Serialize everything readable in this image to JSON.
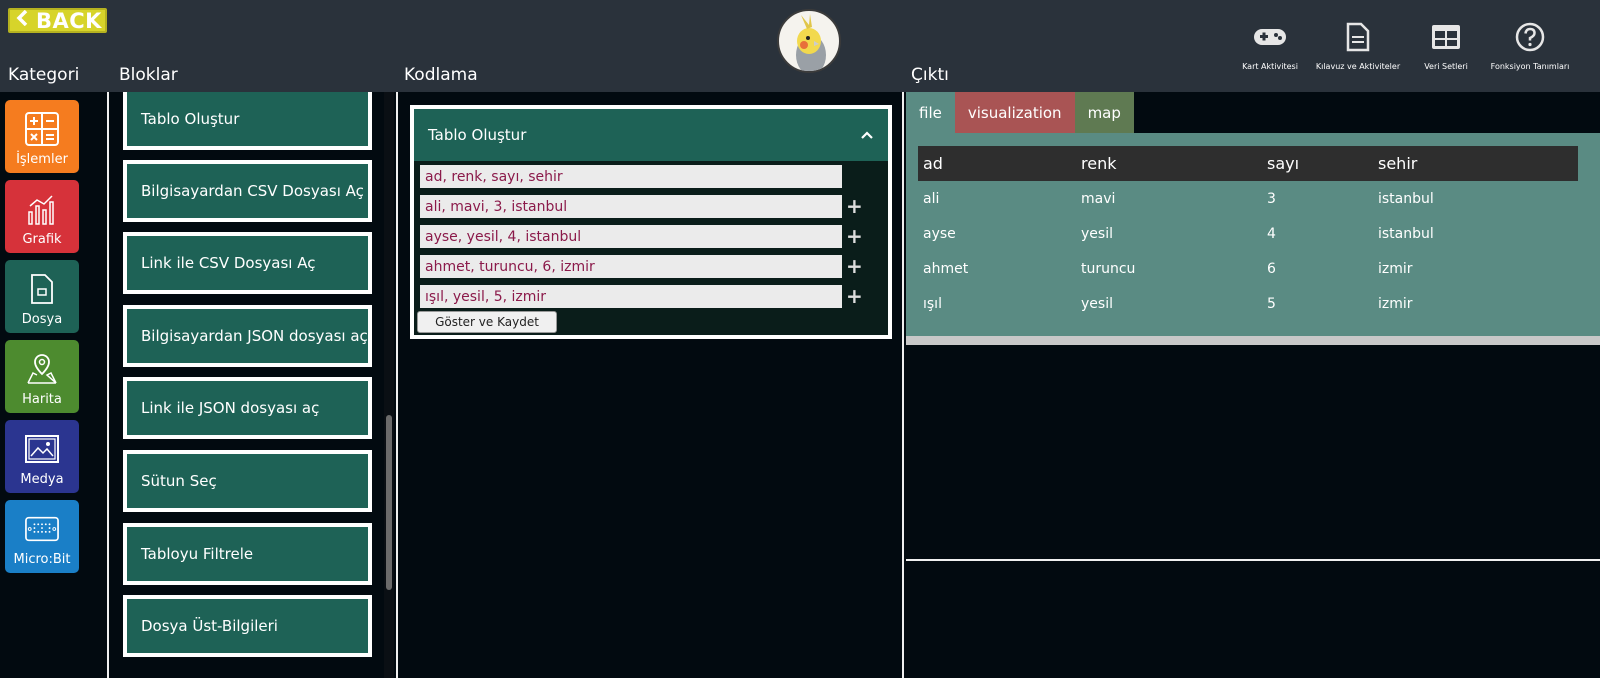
{
  "header": {
    "back_label": "BACK",
    "columns": {
      "kategori": "Kategori",
      "bloklar": "Bloklar",
      "kodlama": "Kodlama",
      "cikti": "Çıktı"
    },
    "icons": [
      {
        "name": "gamepad-icon",
        "label": "Kart Aktivitesi"
      },
      {
        "name": "document-icon",
        "label": "Kılavuz ve Aktiviteler"
      },
      {
        "name": "table-icon",
        "label": "Veri Setleri"
      },
      {
        "name": "help-icon",
        "label": "Fonksiyon Tanımları"
      }
    ]
  },
  "categories": [
    {
      "label": "İşlemler",
      "color": "#f57c1f",
      "icon": "calculator-icon"
    },
    {
      "label": "Grafik",
      "color": "#d6323a",
      "icon": "chart-icon"
    },
    {
      "label": "Dosya",
      "color": "#1e6256",
      "icon": "file-icon"
    },
    {
      "label": "Harita",
      "color": "#4d8b2f",
      "icon": "map-icon"
    },
    {
      "label": "Medya",
      "color": "#2b3590",
      "icon": "image-icon"
    },
    {
      "label": "Micro:Bit",
      "color": "#1a7fc7",
      "icon": "microbit-icon"
    }
  ],
  "blocks": [
    "Tablo Oluştur",
    "Bilgisayardan CSV Dosyası Aç",
    "Link ile CSV Dosyası Aç",
    "Bilgisayardan JSON dosyası aç",
    "Link ile JSON dosyası aç",
    "Sütun Seç",
    "Tabloyu Filtrele",
    "Dosya Üst-Bilgileri"
  ],
  "code_block": {
    "title": "Tablo Oluştur",
    "rows": [
      "ad, renk, sayı, sehir",
      "ali, mavi, 3, istanbul",
      "ayse, yesil, 4, istanbul",
      "ahmet, turuncu, 6, izmir",
      "ışıl, yesil, 5, izmir"
    ],
    "button_label": "Göster ve Kaydet"
  },
  "output": {
    "tabs": [
      {
        "label": "file",
        "color": "#5a8b83"
      },
      {
        "label": "visualization",
        "color": "#a95454"
      },
      {
        "label": "map",
        "color": "#5f7a52"
      }
    ],
    "table": {
      "headers": [
        "ad",
        "renk",
        "sayı",
        "sehir"
      ],
      "rows": [
        [
          "ali",
          "mavi",
          "3",
          "istanbul"
        ],
        [
          "ayse",
          "yesil",
          "4",
          "istanbul"
        ],
        [
          "ahmet",
          "turuncu",
          "6",
          "izmir"
        ],
        [
          "ışıl",
          "yesil",
          "5",
          "izmir"
        ]
      ]
    }
  }
}
